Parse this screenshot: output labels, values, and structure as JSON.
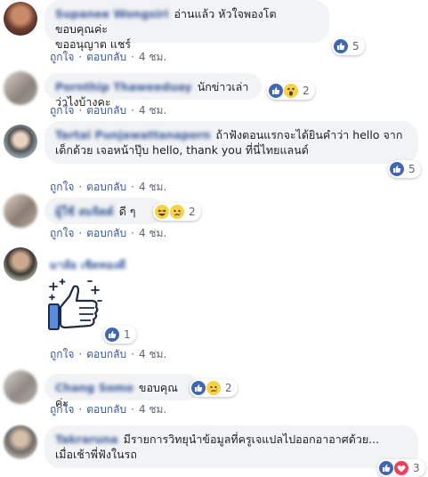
{
  "colors": {
    "link": "#385898",
    "bubble_bg": "#f2f3f5",
    "meta_text": "#606770",
    "like_blue": "#4267b2",
    "reaction_yellow": "#f7d147",
    "love_red": "#f33e58"
  },
  "actions": {
    "like": "ถูกใจ",
    "reply": "ตอบกลับ",
    "sep": "·"
  },
  "comments": [
    {
      "author": "Supanee Wongsiri",
      "text_line1": "อ่านแล้ว หัวใจพองโต ขอบคุณค่ะ",
      "text_line2": "ขออนุญาต แชร์",
      "time": "4 ชม.",
      "reactions": {
        "icons": [
          "like-icon"
        ],
        "count": "5"
      }
    },
    {
      "author": "Pornthip Thaweeduay",
      "text_line1": "นักข่าวเล่าว่าไงบ้างคะ",
      "time": "4 ชม.",
      "reactions": {
        "icons": [
          "like-icon",
          "wow-icon"
        ],
        "count": "2"
      }
    },
    {
      "author": "Tartai Punjawattanaporn",
      "text_line1": "ถ้าฟังตอนแรกจะได้ยินคำว่า hello จาก",
      "text_line2": "เด็กด้วย เจอหน้าปุ๊บ hello, thank you ที่นี่ไทยแลนด์",
      "time": "4 ชม.",
      "reactions": {
        "icons": [
          "like-icon"
        ],
        "count": "5"
      }
    },
    {
      "author": "ผู้ใช้ สมจิตต์",
      "text_line1": "ดี ๆ",
      "time": "4 ชม.",
      "reactions": {
        "icons": [
          "haha-icon",
          "sad-icon"
        ],
        "count": "2"
      }
    },
    {
      "author": "มาลัย เชิดทองดี",
      "sticker": "sparkling-thumbs-up-sticker",
      "time": "4 ชม.",
      "reactions": {
        "icons": [
          "like-icon"
        ],
        "count": "1"
      }
    },
    {
      "author": "Chang Somo",
      "text_line1": "ขอบคุณค่ะ",
      "time": "4 ชม.",
      "reactions": {
        "icons": [
          "like-icon",
          "sad-icon"
        ],
        "count": "2"
      }
    },
    {
      "author": "Takraruna",
      "text_line1": "มีรายการวิทยุนำข้อมูลที่ครูเจแปลไปออกอาอาศด้วย...",
      "text_line2": "เมื่อเช้าพี่ฟังในรถ",
      "reactions": {
        "icons": [
          "like-icon",
          "love-icon"
        ],
        "count": "3"
      }
    }
  ]
}
